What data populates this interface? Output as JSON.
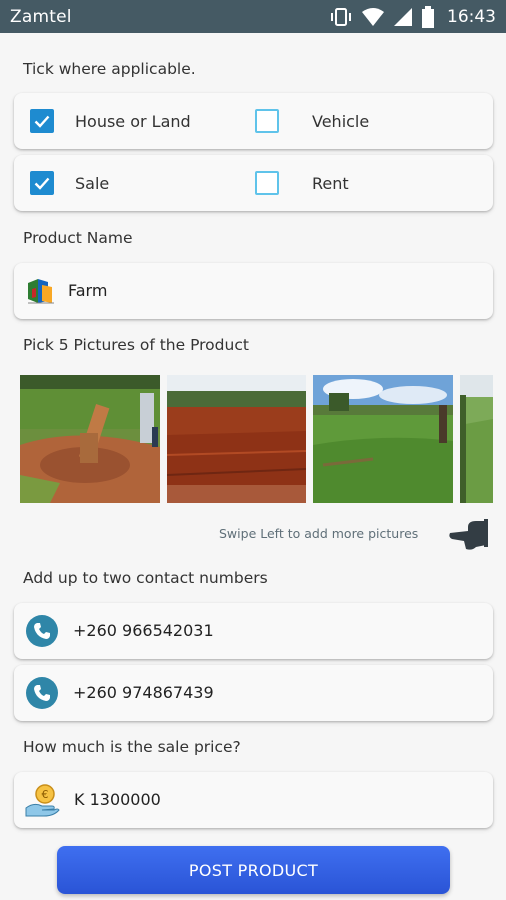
{
  "status_bar": {
    "carrier": "Zamtel",
    "time": "16:43",
    "icons": [
      "vibrate-icon",
      "wifi-icon",
      "signal-icon",
      "battery-icon"
    ]
  },
  "form": {
    "tick_label": "Tick where applicable.",
    "options": [
      {
        "label": "House or Land",
        "checked": true
      },
      {
        "label": "Vehicle",
        "checked": false
      },
      {
        "label": "Sale",
        "checked": true
      },
      {
        "label": "Rent",
        "checked": false
      }
    ],
    "product_name_label": "Product Name",
    "product_name_value": "Farm",
    "pictures_label": "Pick 5 Pictures of the Product",
    "swipe_hint": "Swipe Left to add more pictures",
    "contacts_label": "Add up to two contact numbers",
    "contacts": [
      "+260 966542031",
      "+260 974867439"
    ],
    "price_label": "How much is the sale price?",
    "price_value": "K 1300000",
    "post_button": "POST PRODUCT"
  },
  "colors": {
    "status_bar": "#455a64",
    "checkbox": "#1e8bd0",
    "phone_icon": "#2f86a8",
    "button": "#3561e6"
  }
}
